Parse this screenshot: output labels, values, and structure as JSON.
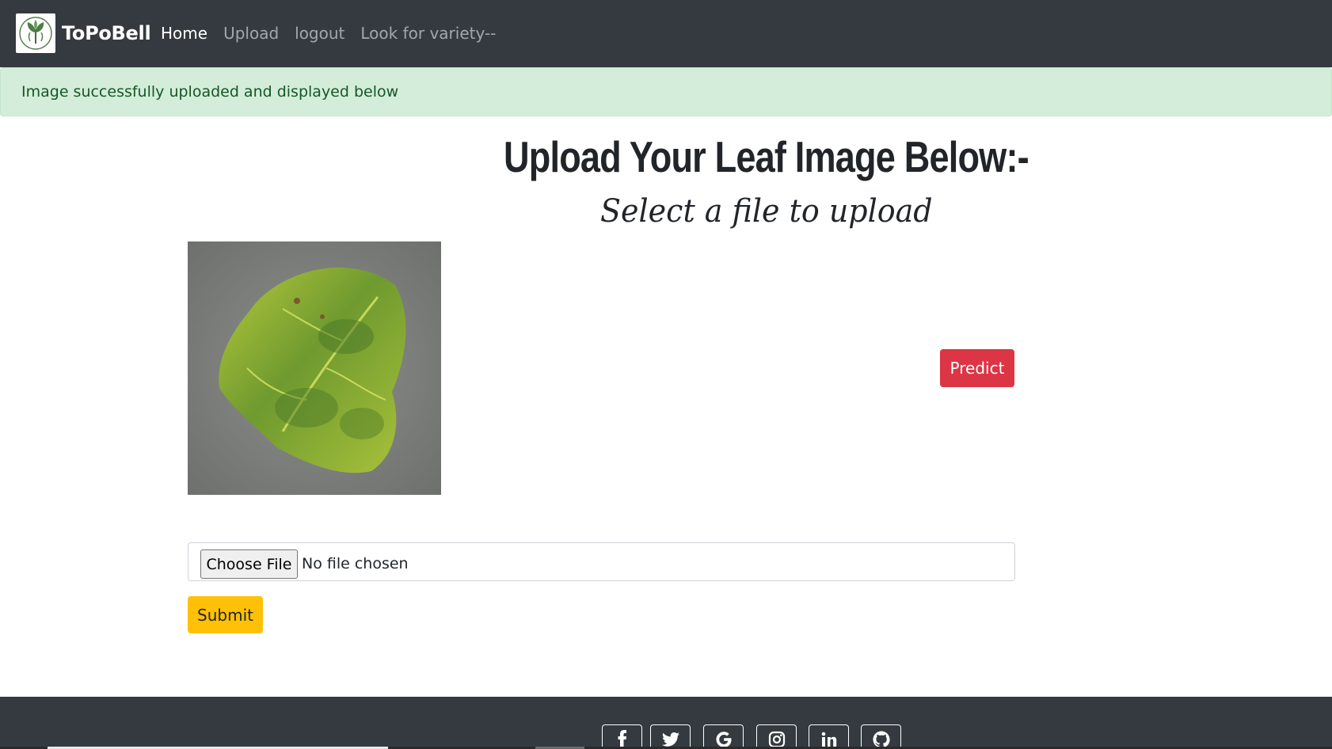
{
  "navbar": {
    "brand_name": "ToPoBell",
    "logo_icon": "leaf-sprout-logo",
    "links": [
      {
        "label": "Home",
        "active": true
      },
      {
        "label": "Upload",
        "active": false
      },
      {
        "label": "logout",
        "active": false
      },
      {
        "label": "Look for variety--",
        "active": false
      }
    ]
  },
  "alert": {
    "message": "Image successfully uploaded and displayed below",
    "color": "#d4edda"
  },
  "main": {
    "heading": "Upload Your Leaf Image Below:-",
    "subheading": "Select a file to upload",
    "predict_label": "Predict",
    "file_input": {
      "button_label": "Choose File",
      "status": "No file chosen"
    },
    "submit_label": "Submit"
  },
  "footer": {
    "social_icons": [
      "facebook-icon",
      "twitter-icon",
      "google-icon",
      "instagram-icon",
      "linkedin-icon",
      "github-icon"
    ]
  },
  "colors": {
    "navbar_bg": "#343a40",
    "predict": "#dc3545",
    "submit": "#ffc107",
    "alert_text": "#155724"
  }
}
